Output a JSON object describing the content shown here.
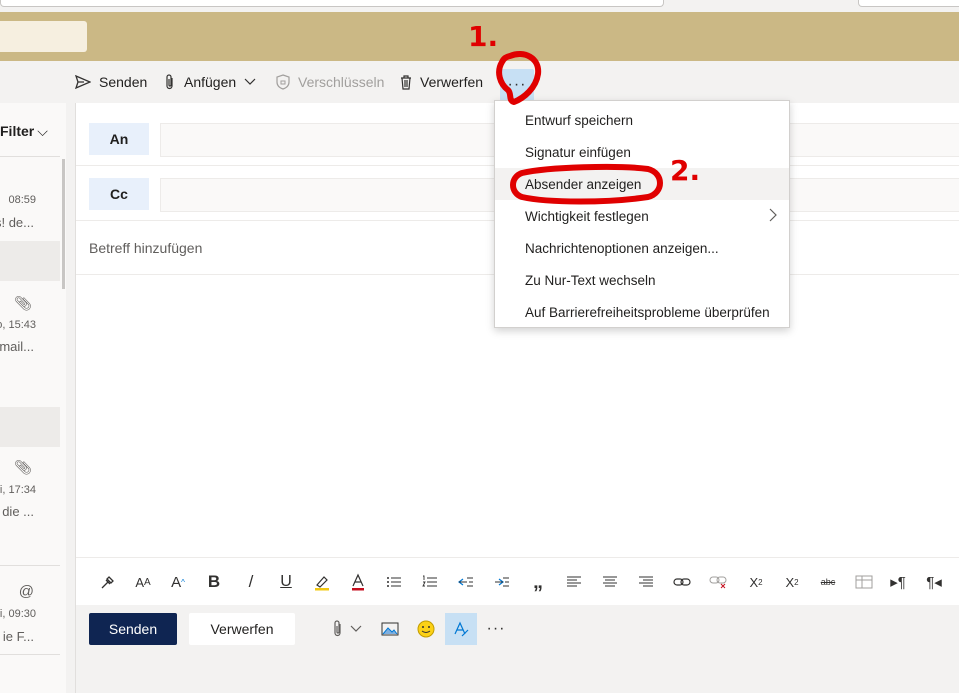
{
  "toolbar": {
    "send_label": "Senden",
    "attach_label": "Anfügen",
    "encrypt_label": "Verschlüsseln",
    "discard_label": "Verwerfen",
    "more_label": "···"
  },
  "mail_list": {
    "filter_label": "Filter",
    "items": [
      {
        "time": "08:59",
        "preview": "s! de..."
      },
      {
        "time": "o, 15:43",
        "preview": "mail..."
      },
      {
        "time": "i, 17:34",
        "preview": "die ..."
      },
      {
        "time": "i, 09:30",
        "preview": "ie F..."
      }
    ]
  },
  "compose": {
    "to_label": "An",
    "cc_label": "Cc",
    "subject_placeholder": "Betreff hinzufügen",
    "send_button": "Senden",
    "discard_button": "Verwerfen",
    "more_label": "···"
  },
  "menu": {
    "items": [
      {
        "label": "Entwurf speichern"
      },
      {
        "label": "Signatur einfügen"
      },
      {
        "label": "Absender anzeigen"
      },
      {
        "label": "Wichtigkeit festlegen"
      },
      {
        "label": "Nachrichtenoptionen anzeigen..."
      },
      {
        "label": "Zu Nur-Text wechseln"
      },
      {
        "label": "Auf Barrierefreiheitsprobleme überprüfen"
      }
    ]
  },
  "annotations": {
    "step1": "1.",
    "step2": "2."
  },
  "colors": {
    "banner": "#cbb885",
    "send_button": "#0f2552",
    "highlight": "#c7e0f4",
    "annotation": "#e00000"
  }
}
